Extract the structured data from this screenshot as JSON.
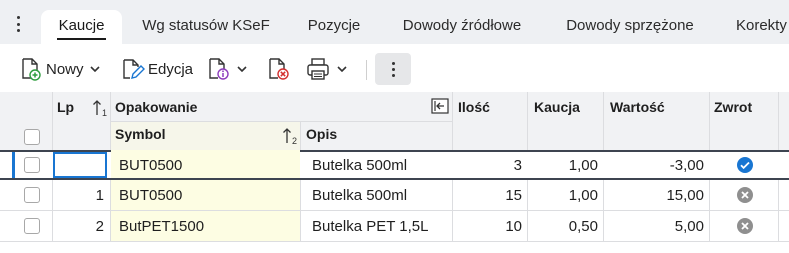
{
  "tabs": [
    {
      "label": "Kaucje",
      "active": true
    },
    {
      "label": "Wg statusów KSeF",
      "active": false
    },
    {
      "label": "Pozycje",
      "active": false
    },
    {
      "label": "Dowody źródłowe",
      "active": false
    },
    {
      "label": "Dowody sprzężone",
      "active": false
    },
    {
      "label": "Korekty",
      "active": false
    }
  ],
  "toolbar": {
    "new_label": "Nowy",
    "edit_label": "Edycja",
    "icons": [
      "new-document-icon",
      "edit-document-icon",
      "document-info-icon",
      "document-delete-icon",
      "printer-icon",
      "more-vertical-icon"
    ]
  },
  "grid": {
    "headers": {
      "lp": "Lp",
      "sort_opakowanie": "1",
      "opakowanie": "Opakowanie",
      "symbol": "Symbol",
      "sort_symbol": "2",
      "opis": "Opis",
      "ilosc": "Ilość",
      "kaucja": "Kaucja",
      "wartosc": "Wartość",
      "zwrot": "Zwrot"
    },
    "rows": [
      {
        "lp": "",
        "symbol": "BUT0500",
        "opis": "Butelka 500ml",
        "ilosc": "3",
        "kaucja": "1,00",
        "wartosc": "-3,00",
        "zwrot": true
      },
      {
        "lp": "1",
        "symbol": "BUT0500",
        "opis": "Butelka 500ml",
        "ilosc": "15",
        "kaucja": "1,00",
        "wartosc": "15,00",
        "zwrot": false
      },
      {
        "lp": "2",
        "symbol": "ButPET1500",
        "opis": "Butelka PET 1,5L",
        "ilosc": "10",
        "kaucja": "0,50",
        "wartosc": "5,00",
        "zwrot": false
      }
    ]
  },
  "colors": {
    "accent": "#1976d2",
    "yellow_cell": "#fdfde3",
    "header_bg": "#f1f2f4",
    "tab_bar_bg": "#eef0f3"
  }
}
